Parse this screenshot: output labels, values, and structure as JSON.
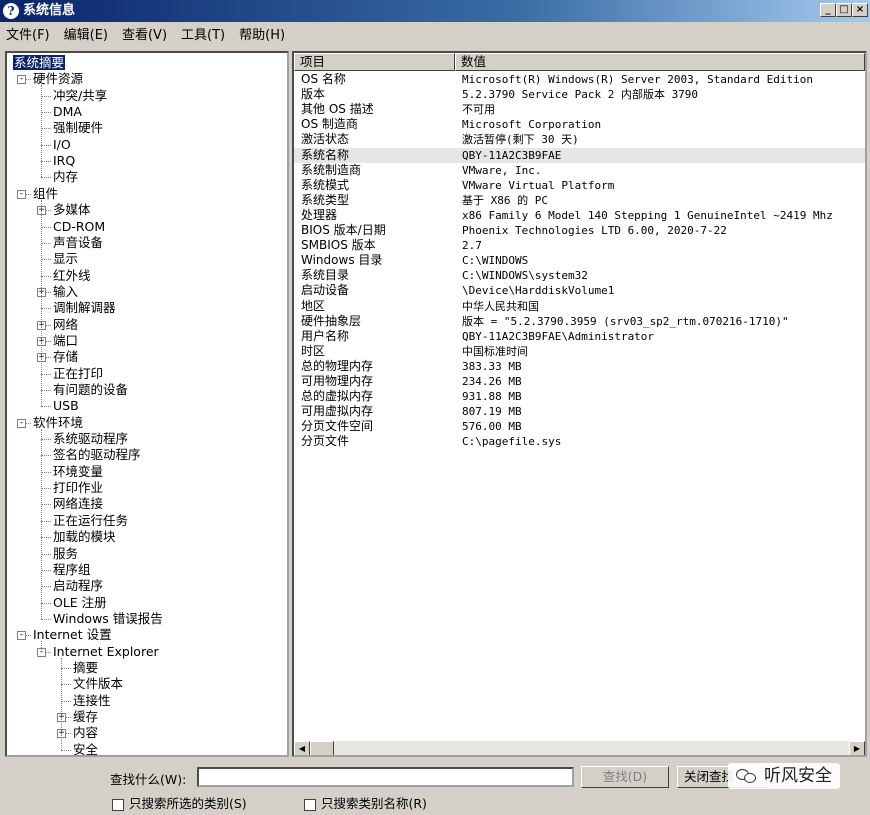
{
  "window": {
    "title": "系统信息",
    "app_icon_glyph": "?",
    "buttons": {
      "minimize": "_",
      "maximize": "□",
      "close": "×"
    }
  },
  "menu": [
    "文件(F)",
    "编辑(E)",
    "查看(V)",
    "工具(T)",
    "帮助(H)"
  ],
  "tree": [
    {
      "label": "系统摘要",
      "level": 0,
      "selected": true,
      "expander": ""
    },
    {
      "label": "硬件资源",
      "level": 1,
      "expander": "-"
    },
    {
      "label": "冲突/共享",
      "level": 2,
      "expander": ""
    },
    {
      "label": "DMA",
      "level": 2,
      "expander": ""
    },
    {
      "label": "强制硬件",
      "level": 2,
      "expander": ""
    },
    {
      "label": "I/O",
      "level": 2,
      "expander": ""
    },
    {
      "label": "IRQ",
      "level": 2,
      "expander": ""
    },
    {
      "label": "内存",
      "level": 2,
      "expander": ""
    },
    {
      "label": "组件",
      "level": 1,
      "expander": "-"
    },
    {
      "label": "多媒体",
      "level": 2,
      "expander": "+"
    },
    {
      "label": "CD-ROM",
      "level": 2,
      "expander": ""
    },
    {
      "label": "声音设备",
      "level": 2,
      "expander": ""
    },
    {
      "label": "显示",
      "level": 2,
      "expander": ""
    },
    {
      "label": "红外线",
      "level": 2,
      "expander": ""
    },
    {
      "label": "输入",
      "level": 2,
      "expander": "+"
    },
    {
      "label": "调制解调器",
      "level": 2,
      "expander": ""
    },
    {
      "label": "网络",
      "level": 2,
      "expander": "+"
    },
    {
      "label": "端口",
      "level": 2,
      "expander": "+"
    },
    {
      "label": "存储",
      "level": 2,
      "expander": "+"
    },
    {
      "label": "正在打印",
      "level": 2,
      "expander": ""
    },
    {
      "label": "有问题的设备",
      "level": 2,
      "expander": ""
    },
    {
      "label": "USB",
      "level": 2,
      "expander": ""
    },
    {
      "label": "软件环境",
      "level": 1,
      "expander": "-"
    },
    {
      "label": "系统驱动程序",
      "level": 2,
      "expander": ""
    },
    {
      "label": "签名的驱动程序",
      "level": 2,
      "expander": ""
    },
    {
      "label": "环境变量",
      "level": 2,
      "expander": ""
    },
    {
      "label": "打印作业",
      "level": 2,
      "expander": ""
    },
    {
      "label": "网络连接",
      "level": 2,
      "expander": ""
    },
    {
      "label": "正在运行任务",
      "level": 2,
      "expander": ""
    },
    {
      "label": "加载的模块",
      "level": 2,
      "expander": ""
    },
    {
      "label": "服务",
      "level": 2,
      "expander": ""
    },
    {
      "label": "程序组",
      "level": 2,
      "expander": ""
    },
    {
      "label": "启动程序",
      "level": 2,
      "expander": ""
    },
    {
      "label": "OLE 注册",
      "level": 2,
      "expander": ""
    },
    {
      "label": "Windows 错误报告",
      "level": 2,
      "expander": ""
    },
    {
      "label": "Internet 设置",
      "level": 1,
      "expander": "-"
    },
    {
      "label": "Internet Explorer",
      "level": 2,
      "expander": "-"
    },
    {
      "label": "摘要",
      "level": 3,
      "expander": ""
    },
    {
      "label": "文件版本",
      "level": 3,
      "expander": ""
    },
    {
      "label": "连接性",
      "level": 3,
      "expander": ""
    },
    {
      "label": "缓存",
      "level": 3,
      "expander": "+"
    },
    {
      "label": "内容",
      "level": 3,
      "expander": "+"
    },
    {
      "label": "安全",
      "level": 3,
      "expander": ""
    }
  ],
  "list": {
    "columns": [
      "项目",
      "数值"
    ],
    "highlighted_row": 5,
    "rows": [
      [
        "OS 名称",
        "Microsoft(R) Windows(R) Server 2003, Standard Edition"
      ],
      [
        "版本",
        "5.2.3790 Service Pack 2 内部版本 3790"
      ],
      [
        "其他 OS 描述",
        "不可用"
      ],
      [
        "OS 制造商",
        "Microsoft Corporation"
      ],
      [
        "激活状态",
        "激活暂停(剩下 30 天)"
      ],
      [
        "系统名称",
        "QBY-11A2C3B9FAE"
      ],
      [
        "系统制造商",
        "VMware, Inc."
      ],
      [
        "系统模式",
        "VMware Virtual Platform"
      ],
      [
        "系统类型",
        "基于 X86 的 PC"
      ],
      [
        "处理器",
        "x86 Family 6 Model 140 Stepping 1 GenuineIntel ~2419 Mhz"
      ],
      [
        "BIOS 版本/日期",
        "Phoenix Technologies LTD 6.00, 2020-7-22"
      ],
      [
        "SMBIOS 版本",
        "2.7"
      ],
      [
        "Windows 目录",
        "C:\\WINDOWS"
      ],
      [
        "系统目录",
        "C:\\WINDOWS\\system32"
      ],
      [
        "启动设备",
        "\\Device\\HarddiskVolume1"
      ],
      [
        "地区",
        "中华人民共和国"
      ],
      [
        "硬件抽象层",
        "版本 = \"5.2.3790.3959 (srv03_sp2_rtm.070216-1710)\""
      ],
      [
        "用户名称",
        "QBY-11A2C3B9FAE\\Administrator"
      ],
      [
        "时区",
        "中国标准时间"
      ],
      [
        "总的物理内存",
        "383.33 MB"
      ],
      [
        "可用物理内存",
        "234.26 MB"
      ],
      [
        "总的虚拟内存",
        "931.88 MB"
      ],
      [
        "可用虚拟内存",
        "807.19 MB"
      ],
      [
        "分页文件空间",
        "576.00 MB"
      ],
      [
        "分页文件",
        "C:\\pagefile.sys"
      ]
    ]
  },
  "scrollbar": {
    "left_arrow": "◀",
    "right_arrow": "▶"
  },
  "find": {
    "label": "查找什么(W):",
    "value": "",
    "find_button": "查找(D)",
    "close_button": "关闭查找",
    "checkbox_selected": "只搜索所选的类别(S)",
    "checkbox_names": "只搜索类别名称(R)"
  },
  "watermark": {
    "text": "听风安全",
    "icon": "wechat-icon"
  }
}
